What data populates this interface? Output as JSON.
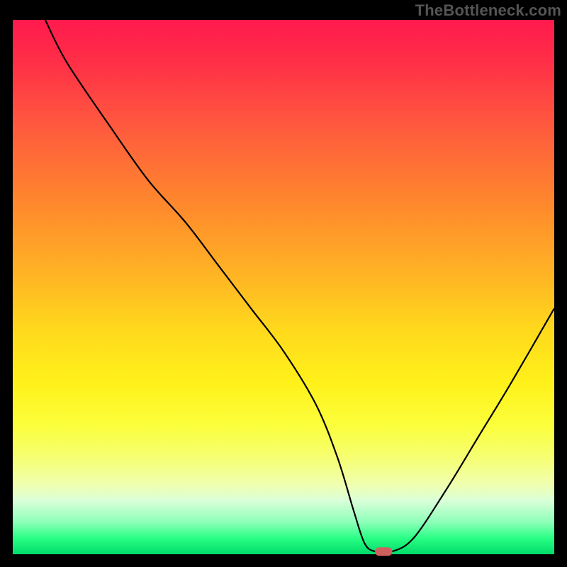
{
  "watermark": "TheBottleneck.com",
  "chart_data": {
    "type": "line",
    "title": "",
    "xlabel": "",
    "ylabel": "",
    "xlim": [
      0,
      100
    ],
    "ylim": [
      0,
      100
    ],
    "grid": false,
    "legend": false,
    "series": [
      {
        "name": "bottleneck-curve",
        "x": [
          6,
          10,
          18,
          25,
          32,
          38,
          44,
          50,
          56,
          60,
          63,
          65,
          67,
          70,
          74,
          80,
          86,
          92,
          100
        ],
        "y": [
          100,
          92,
          80,
          70,
          62,
          54,
          46,
          38,
          28,
          18,
          8,
          2,
          0.5,
          0.5,
          3,
          12,
          22,
          32,
          46
        ]
      }
    ],
    "marker": {
      "x": 68.5,
      "y": 0.5,
      "shape": "rounded-rect",
      "color": "#d06060"
    },
    "background_gradient": {
      "orientation": "vertical",
      "stops": [
        {
          "pos": 0.0,
          "color": "#ff1a4d"
        },
        {
          "pos": 0.35,
          "color": "#ff8a2c"
        },
        {
          "pos": 0.68,
          "color": "#fff11a"
        },
        {
          "pos": 0.9,
          "color": "#d9ffd9"
        },
        {
          "pos": 1.0,
          "color": "#00db68"
        }
      ]
    }
  }
}
